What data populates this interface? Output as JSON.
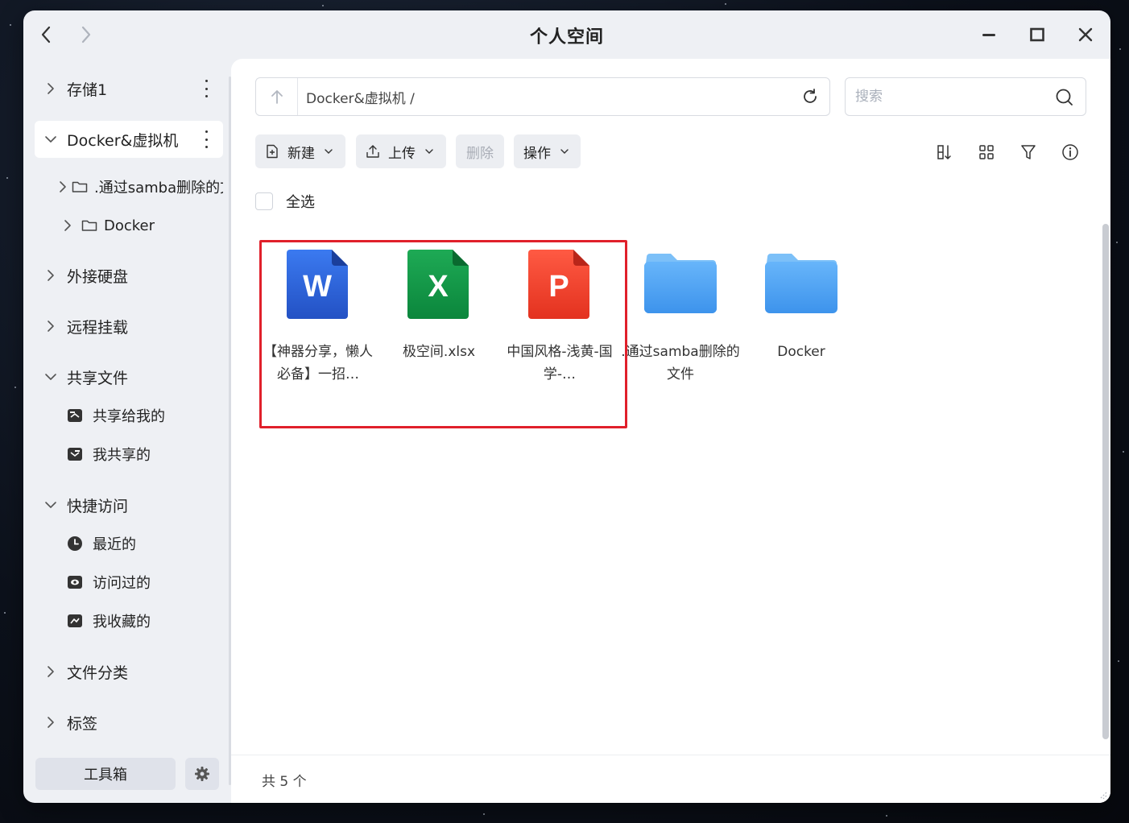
{
  "window": {
    "title": "个人空间"
  },
  "sidebar": {
    "storage1": "存储1",
    "docker_vm": "Docker&虚拟机",
    "docker_children": [
      ".通过samba删除的文件",
      "Docker"
    ],
    "external_drive": "外接硬盘",
    "remote_mount": "远程挂载",
    "shared_files": "共享文件",
    "shared_children": [
      "共享给我的",
      "我共享的"
    ],
    "quick_access": "快捷访问",
    "quick_children": [
      "最近的",
      "访问过的",
      "我收藏的"
    ],
    "file_category": "文件分类",
    "tags": "标签",
    "toolbox": "工具箱"
  },
  "pathbar": {
    "path": "Docker&虚拟机 /"
  },
  "search": {
    "placeholder": "搜索"
  },
  "toolbar": {
    "new": "新建",
    "upload": "上传",
    "delete": "删除",
    "actions": "操作"
  },
  "select_all": "全选",
  "files": [
    {
      "name": "【神器分享，懒人必备】一招…",
      "type": "word",
      "letter": "W"
    },
    {
      "name": "极空间.xlsx",
      "type": "excel",
      "letter": "X"
    },
    {
      "name": "中国风格-浅黄-国学-…",
      "type": "ppt",
      "letter": "P"
    },
    {
      "name": ".通过samba删除的文件",
      "type": "folder"
    },
    {
      "name": "Docker",
      "type": "folder"
    }
  ],
  "status": {
    "count_text": "共 5 个"
  },
  "colors": {
    "word": "#2b63d8",
    "excel": "#139747",
    "ppt": "#f0432f",
    "folder": "#4fa6f5",
    "highlight": "#e0202b"
  }
}
